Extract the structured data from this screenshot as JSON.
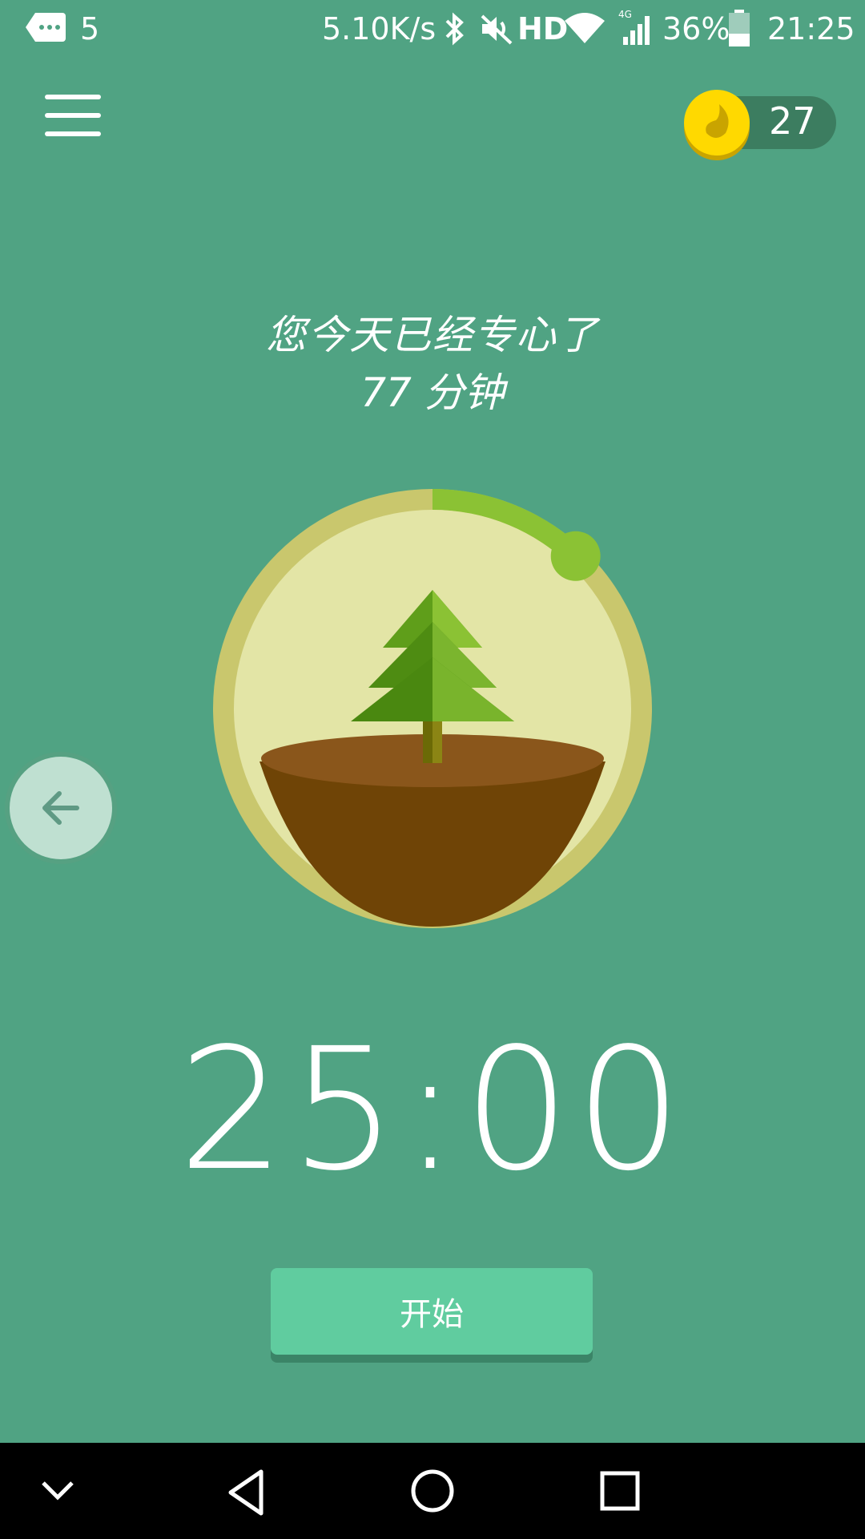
{
  "status_bar": {
    "message_icon": "message-icon",
    "notification_count": "5",
    "network_speed": "5.10K/s",
    "bluetooth_icon": "bluetooth-icon",
    "mute_icon": "mute-icon",
    "hd": "HD",
    "wifi_icon": "wifi-icon",
    "signal_icon": "signal-4g-icon",
    "battery_percent": "36%",
    "battery_icon": "battery-icon",
    "time": "21:25"
  },
  "header": {
    "menu_icon": "menu-icon",
    "coin_icon": "coin-icon",
    "coins": "27"
  },
  "focus_summary": {
    "line1": "您今天已经专心了",
    "line2": "77 分钟"
  },
  "tree": {
    "progress": 0.12,
    "colors": {
      "ring": "#c9c76d",
      "inner": "#e3e5a6",
      "progress": "#8bc234",
      "soil": "#6f4406"
    }
  },
  "timer": "25:00",
  "start_button": "开始",
  "back_icon": "arrow-left-icon",
  "navigation_bar": {
    "collapse_icon": "chevron-down-icon",
    "back_icon": "triangle-back-icon",
    "home_icon": "circle-home-icon",
    "recents_icon": "square-recents-icon"
  },
  "colors": {
    "background": "#50a383",
    "button": "#60cc9f"
  }
}
